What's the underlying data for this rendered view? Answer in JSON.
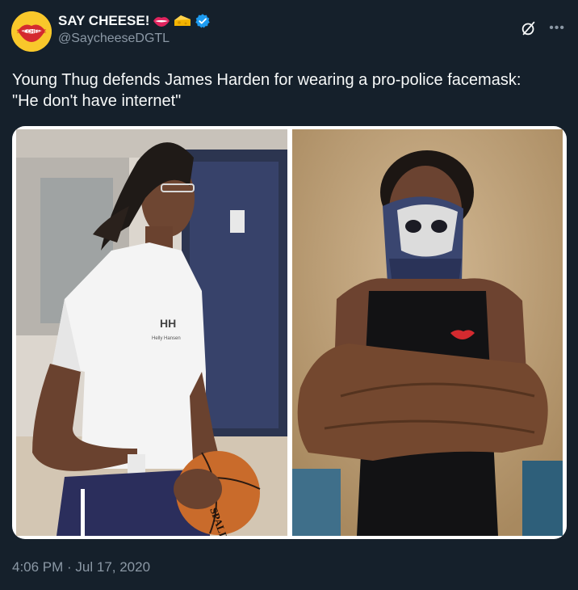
{
  "account": {
    "display_name": "SAY CHEESE!",
    "handle": "@SaycheeseDGTL",
    "verified": true,
    "name_emojis": [
      "lips-emoji",
      "cheese-emoji"
    ],
    "avatar_text": "SAY CHEESE",
    "avatar_color": "#f9c82b"
  },
  "tweet": {
    "text_line1": "Young Thug defends James Harden for wearing a pro-police facemask:",
    "text_line2": "\"He don't have internet\"",
    "timestamp": "4:06 PM · Jul 17, 2020"
  },
  "media": {
    "left_photo": {
      "subject": "man-in-white-tshirt-holding-basketball",
      "shirt_text_1": "HH",
      "shirt_text_2": "Helly Hansen",
      "ball_text": "SPALDING"
    },
    "right_photo": {
      "subject": "man-in-skull-facemask-arms-crossed"
    }
  },
  "colors": {
    "background": "#15202b",
    "text_primary": "#f7f9f9",
    "text_secondary": "#8b98a5",
    "verified": "#1d9bf0"
  }
}
